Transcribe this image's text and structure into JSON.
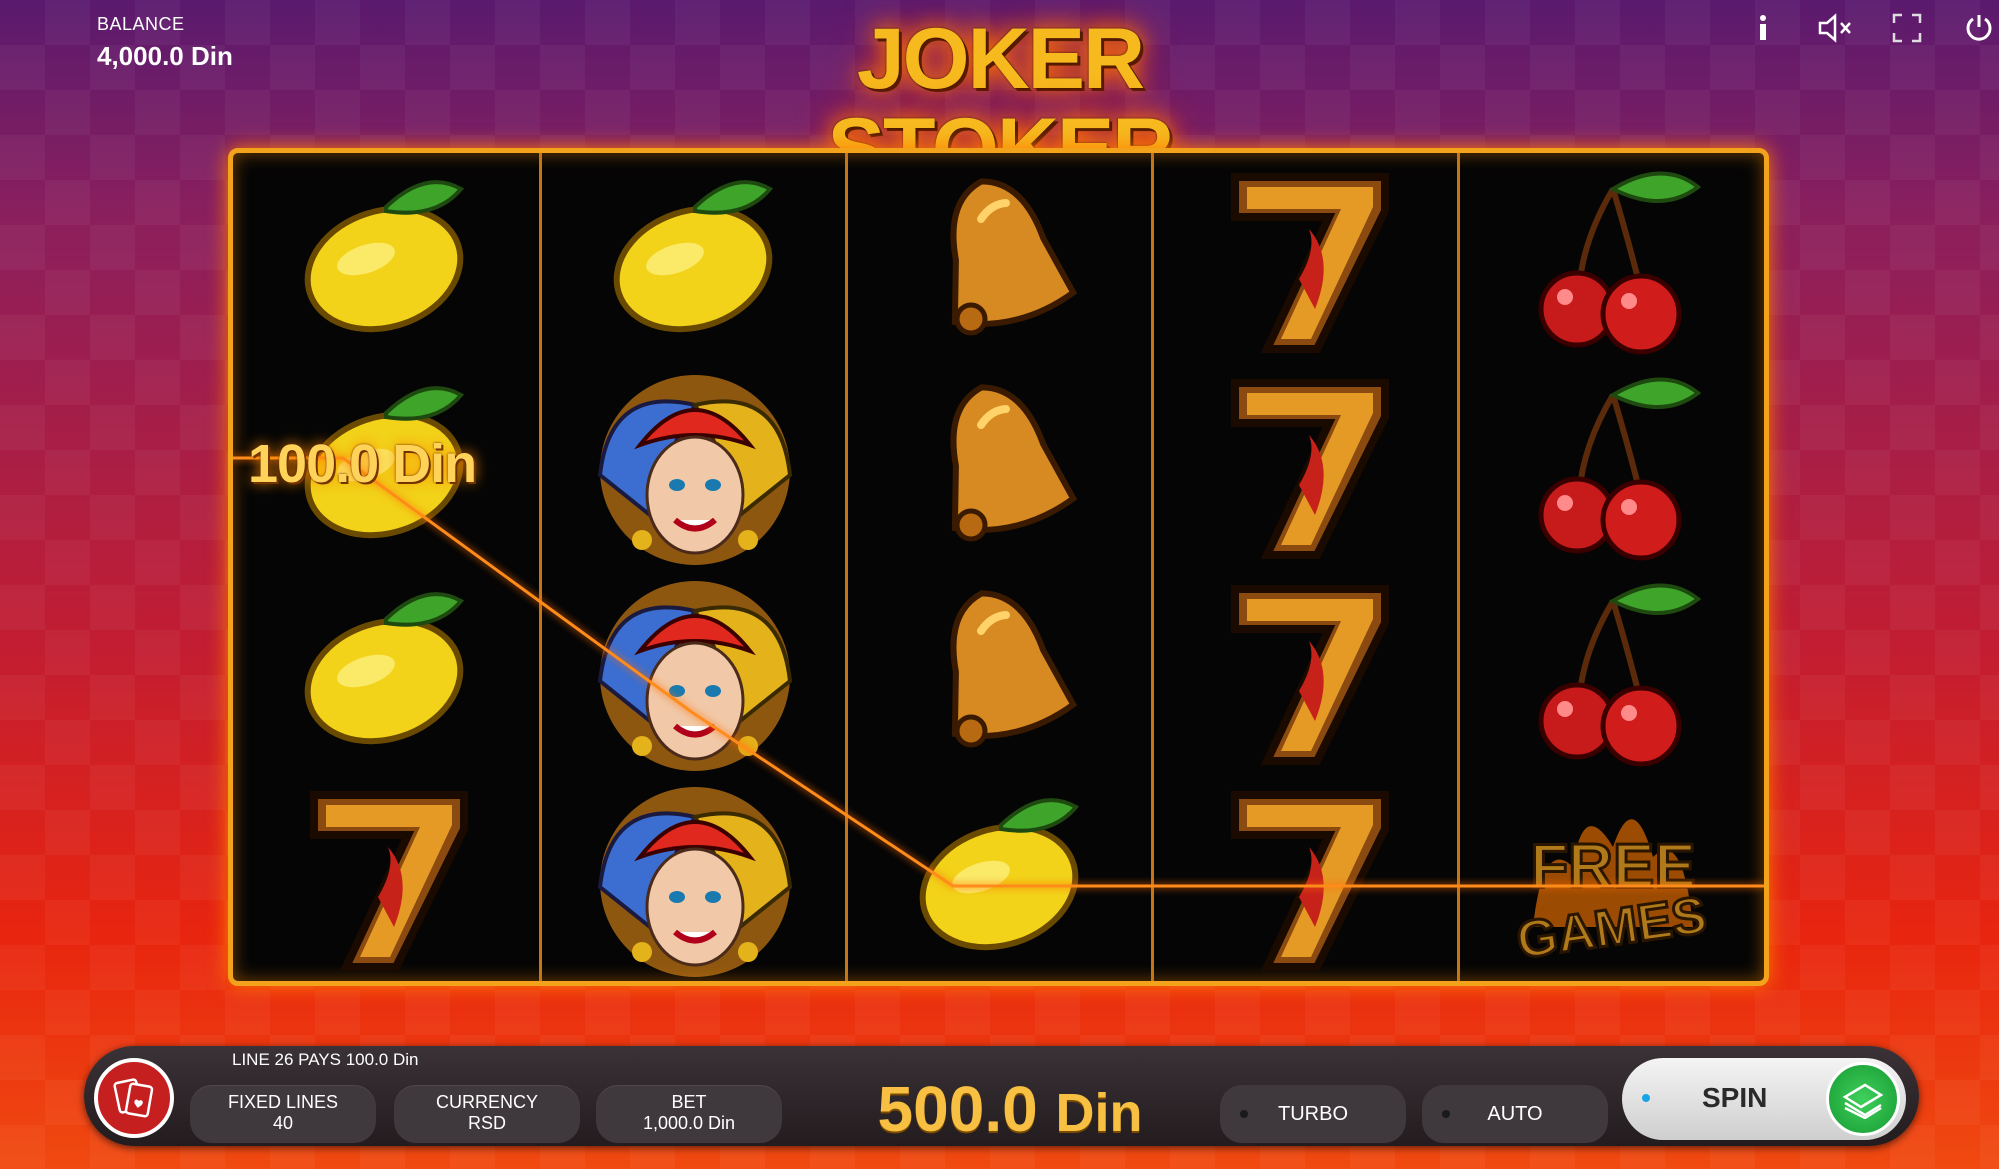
{
  "balance": {
    "label": "BALANCE",
    "value": "4,000.0 Din"
  },
  "title": "JOKER STOKER",
  "top_icons": [
    "info-icon",
    "sound-off-icon",
    "fullscreen-icon",
    "power-icon"
  ],
  "reels": [
    [
      "lemon",
      "lemon",
      "lemon",
      "seven"
    ],
    [
      "lemon",
      "joker",
      "joker",
      "joker"
    ],
    [
      "bell",
      "bell",
      "bell",
      "lemon"
    ],
    [
      "seven",
      "seven",
      "seven",
      "seven"
    ],
    [
      "cherry",
      "cherry",
      "cherry",
      "free-games"
    ]
  ],
  "free_games_text": {
    "line1": "FREE",
    "line2": "GAMES"
  },
  "win_label": "100.0 Din",
  "panel": {
    "line_info": "LINE 26 PAYS  100.0 Din",
    "fixed_lines": {
      "label": "FIXED LINES",
      "value": "40"
    },
    "currency": {
      "label": "CURRENCY",
      "value": "RSD"
    },
    "bet": {
      "label": "BET",
      "value": "1,000.0 Din"
    },
    "win": {
      "amount": "500.0",
      "currency": "Din"
    },
    "turbo": "TURBO",
    "auto": "AUTO",
    "spin": "SPIN"
  },
  "colors": {
    "frame": "#f3a21c",
    "spin_green": "#2fbf4a",
    "menu_red": "#c5201f",
    "win_gold": "#f7c042"
  }
}
